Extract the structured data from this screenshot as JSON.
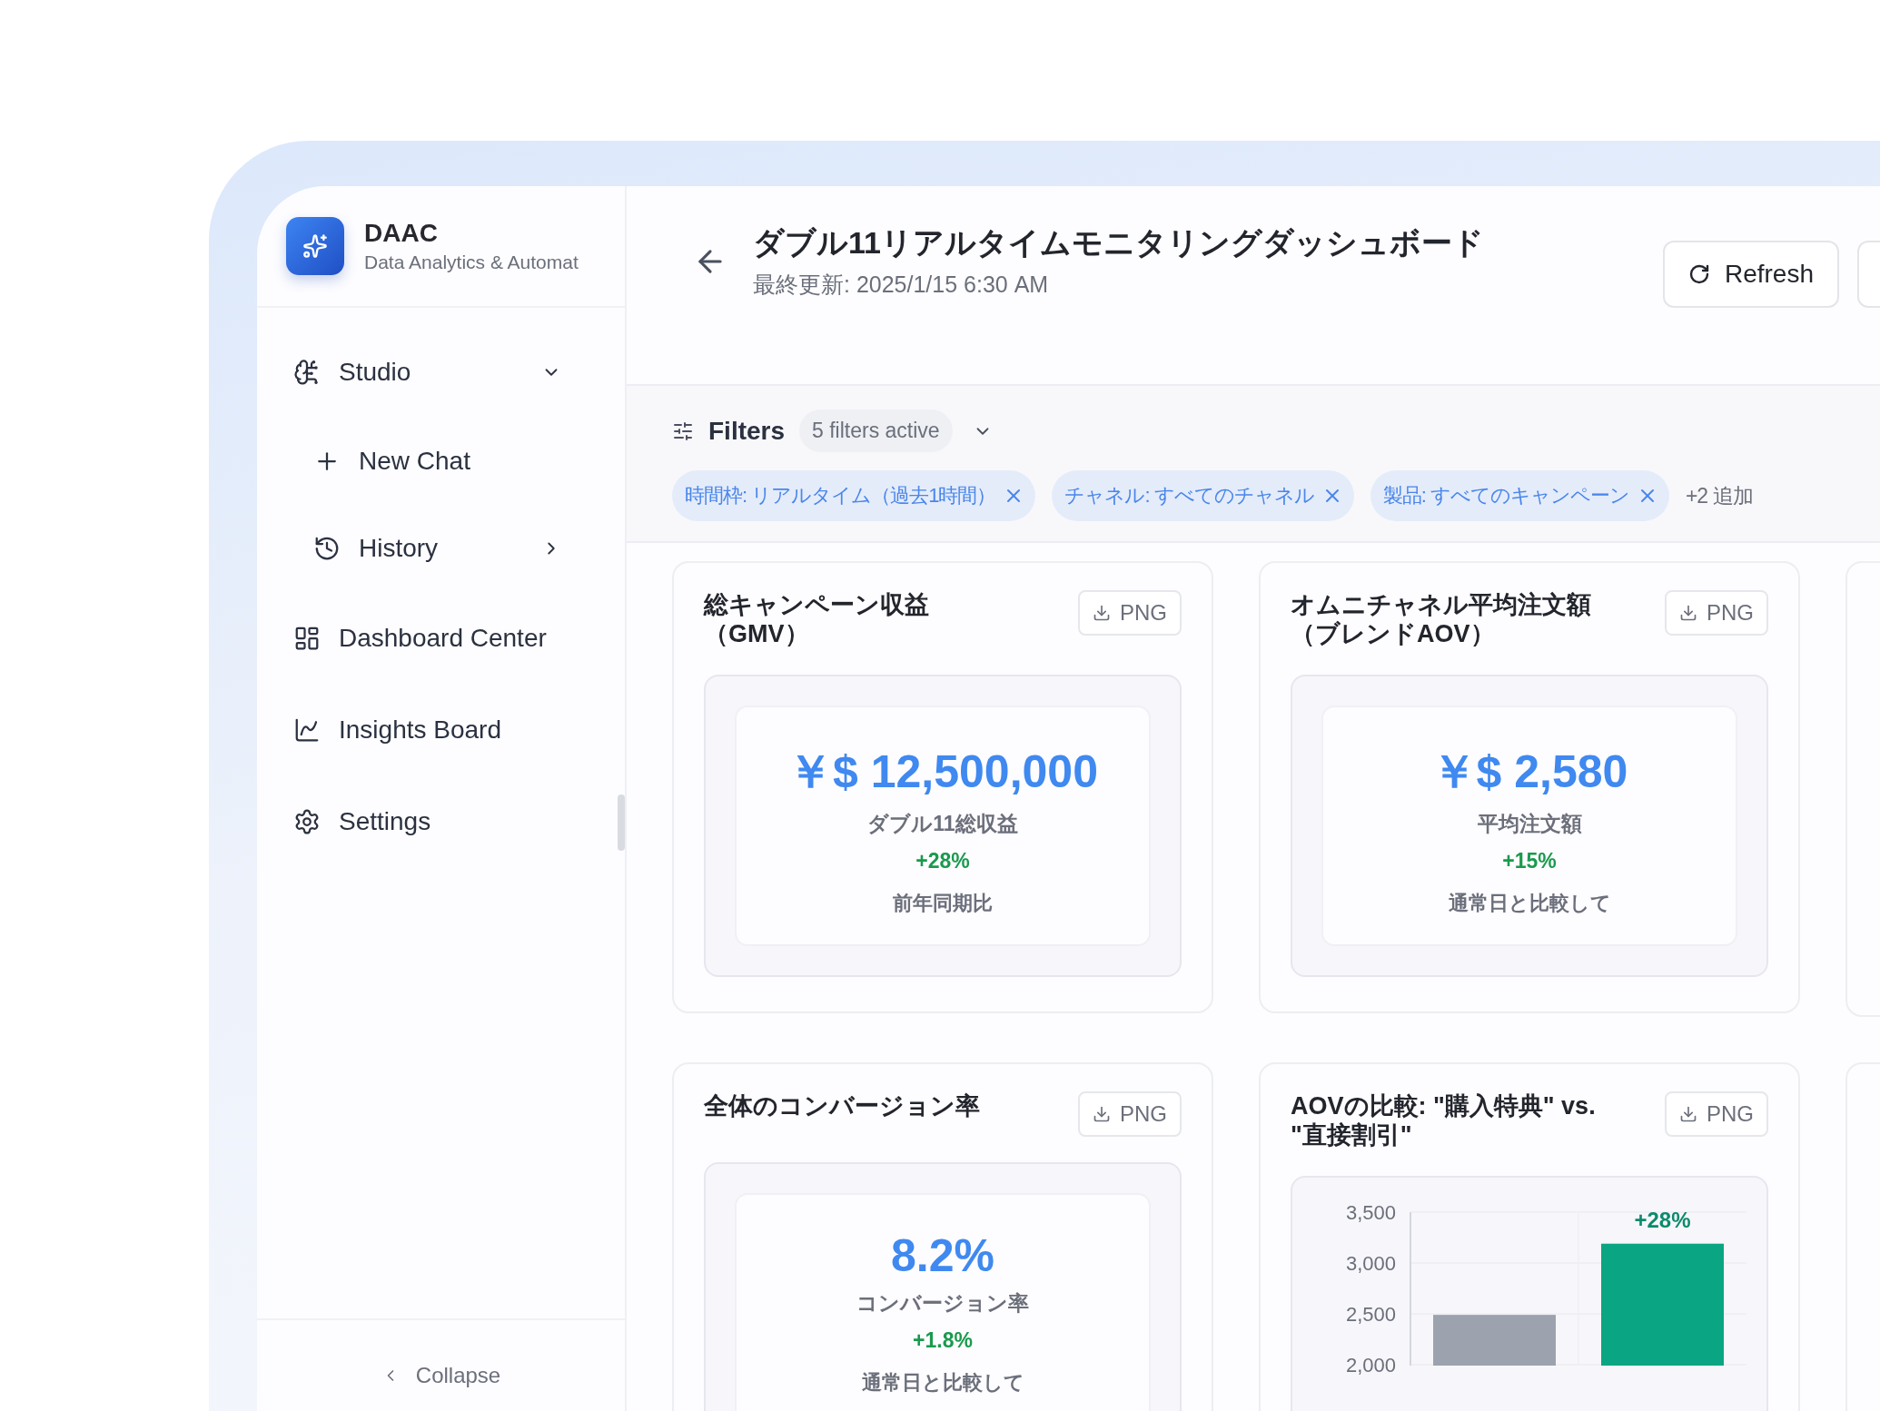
{
  "app": {
    "name": "DAAC",
    "subtitle": "Data Analytics & Automat"
  },
  "sidebar": {
    "items": [
      {
        "label": "Studio",
        "expanded": true,
        "children": [
          {
            "label": "New Chat"
          },
          {
            "label": "History",
            "expanded": false
          }
        ]
      },
      {
        "label": "Dashboard Center"
      },
      {
        "label": "Insights Board"
      },
      {
        "label": "Settings"
      }
    ],
    "collapse": "Collapse"
  },
  "header": {
    "title": "ダブル11リアルタイムモニタリングダッシュボード",
    "updated": "最終更新: 2025/1/15 6:30 AM",
    "refresh": "Refresh"
  },
  "filters": {
    "label": "Filters",
    "count": "5 filters active",
    "expanded": false,
    "chips": [
      "時間枠: リアルタイム（過去1時間）",
      "チャネル: すべてのチャネル",
      "製品: すべてのキャンペーン"
    ],
    "more": "+2 追加"
  },
  "cards": [
    {
      "kind": "metric",
      "title": [
        "総キャンペーン収益",
        "（GMV）"
      ],
      "export": "PNG",
      "value": "￥$ 12,500,000",
      "caption": "ダブル11総収益",
      "change": "+28%",
      "note": "前年同期比"
    },
    {
      "kind": "metric",
      "title": [
        "オムニチャネル平均注文額",
        "（ブレンドAOV）"
      ],
      "export": "PNG",
      "value": "￥$ 2,580",
      "caption": "平均注文額",
      "change": "+15%",
      "note": "通常日と比較して"
    },
    {
      "kind": "metric",
      "title": [
        "全体のコンバージョン率"
      ],
      "export": "PNG",
      "value": "8.2%",
      "caption": "コンバージョン率",
      "change": "+1.8%",
      "note": "通常日と比較して"
    },
    {
      "kind": "chart",
      "title": [
        "AOVの比較: \"購入特典\" vs.",
        "\"直接割引\""
      ],
      "export": "PNG",
      "chart_data": {
        "type": "bar",
        "ylim": [
          2000,
          3500
        ],
        "yticks": [
          {
            "value": 2000,
            "label": "2,000"
          },
          {
            "value": 2500,
            "label": "2,500"
          },
          {
            "value": 3000,
            "label": "3,000"
          },
          {
            "value": 3500,
            "label": "3,500"
          }
        ],
        "series": [
          {
            "color": "#9ca3af",
            "values": [
              2490,
              null
            ]
          },
          {
            "color": "#0aa683",
            "values": [
              null,
              3190
            ]
          }
        ],
        "annotations": [
          "+28%"
        ]
      }
    }
  ]
}
